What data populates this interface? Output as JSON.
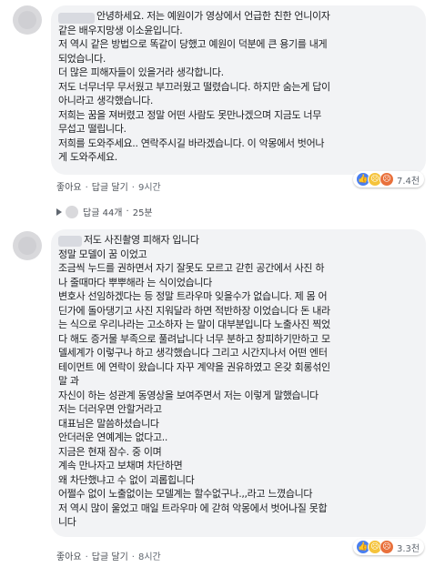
{
  "comment1": {
    "lines": [
      "안녕하세요. 저는 예원이가 영상에서 언급한 친한 언니이자",
      "같은 배우지망생 이소윤입니다.",
      "저 역시 같은 방법으로 똑같이 당했고 예원이 덕분에 큰 용기를 내게",
      "되었습니다.",
      "더 많은 피해자들이 있을거라 생각합니다.",
      "저도 너무너무 무서웠고 부끄러웠고 떨렸습니다. 하지만 숨는게 답이",
      "아니라고 생각했습니다.",
      "저희는 꿈을 져버렸고 정말 어떤 사람도 못만나겠으며 지금도 너무",
      "무섭고 떨립니다.",
      "저희를 도와주세요.. 연락주시길 바라겠습니다. 이 악몽에서 벗어나",
      "게 도와주세요."
    ],
    "reaction_count": "7.4천",
    "like_label": "좋아요",
    "reply_label": "답글 달기",
    "time": "9시간",
    "replies_label": "답글 44개",
    "replies_time": "25분"
  },
  "comment2": {
    "lines": [
      "저도 사진촬영 피해자 입니다",
      "정말 모델이 꿈 이었고",
      "조금씩 누드를 권하면서 자기 잘못도 모르고 갇힌 공간에서 사진 하",
      "나 줄때마다 뿌뿌해라 는 식이었습니다",
      "변호사 선임하겠다는 등 정말 트라우마 잊을수가 없습니다. 제 몸 어",
      "딘가에 돌아댕기고 사진 지워달라 하면 적반하장 이었습니다 돈 내라",
      "는 식으로 우리나라는 고소하자 는 말이 대부분입니다 노출사진 찍었",
      "다 해도 증거물 부족으로 풀려납니다 너무 분하고 창피하기만하고 모",
      "델세계가 이렇구나 하고 생각했습니다 그리고 시간지나서 어떤 엔터",
      "테이먼트 에 연락이 왔습니다 자꾸 계약을 권유하였고 온갖 회롱섞인",
      "말 과",
      "자신이 하는 성관계 동영상을 보여주면서 저는 이렇게 말했습니다",
      "저는 더러우면 안할거라고",
      "대표님은 말씀하셨습니다",
      "안더러운 연예계는 없다고..",
      "지금은 현재 잠수. 중 이며",
      "계속 만나자고 보채며 차단하면",
      "왜 차단했냐고 수 없이 괴롭힙니다",
      "어쩔수 없이 노출없이는 모델계는 할수없구나.,,라고 느꼈습니다",
      "저 역시 많이 울었고 매일 트라우마 에 갇혀 악몽에서 벗어나질 못합",
      "니다"
    ],
    "reaction_count": "3.3천",
    "like_label": "좋아요",
    "reply_label": "답글 달기",
    "time": "8시간"
  },
  "separator": "·",
  "icons": {
    "like": "like-icon",
    "sad": "sad-icon",
    "angry": "angry-icon",
    "reply_arrow": "reply-arrow-icon"
  },
  "colors": {
    "bubble": "#f2f3f5",
    "like": "#4a7ff0",
    "sad": "#f5c33b",
    "angry": "#e9713c",
    "meta": "#606770"
  }
}
